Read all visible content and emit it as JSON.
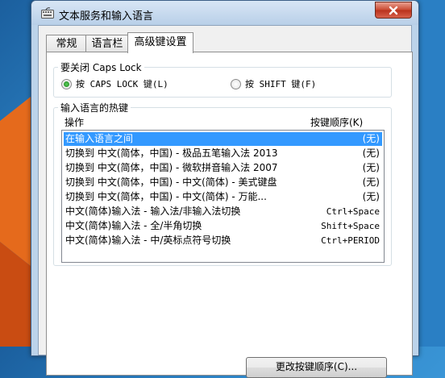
{
  "window": {
    "title": "文本服务和输入语言"
  },
  "tabs": [
    {
      "label": "常规",
      "active": false
    },
    {
      "label": "语言栏",
      "active": false
    },
    {
      "label": "高级键设置",
      "active": true
    }
  ],
  "caps_lock": {
    "group_title": "要关闭 Caps Lock",
    "options": [
      {
        "label": "按 CAPS LOCK 键(L)",
        "selected": true
      },
      {
        "label": "按 SHIFT 键(F)",
        "selected": false
      }
    ]
  },
  "hotkeys": {
    "group_title": "输入语言的热键",
    "col_action": "操作",
    "col_key": "按键顺序(K)",
    "rows": [
      {
        "action": "在输入语言之间",
        "key": "(无)",
        "selected": true
      },
      {
        "action": "切换到 中文(简体，中国) - 极品五笔输入法 2013",
        "key": "(无)",
        "selected": false
      },
      {
        "action": "切换到 中文(简体，中国) - 微软拼音输入法 2007",
        "key": "(无)",
        "selected": false
      },
      {
        "action": "切换到 中文(简体，中国) - 中文(简体) - 美式键盘",
        "key": "(无)",
        "selected": false
      },
      {
        "action": "切换到 中文(简体，中国) - 中文(简体) - 万能...",
        "key": "(无)",
        "selected": false
      },
      {
        "action": "中文(简体)输入法 - 输入法/非输入法切换",
        "key": "Ctrl+Space",
        "selected": false
      },
      {
        "action": "中文(简体)输入法 - 全/半角切换",
        "key": "Shift+Space",
        "selected": false
      },
      {
        "action": "中文(简体)输入法 - 中/英标点符号切换",
        "key": "Ctrl+PERIOD",
        "selected": false
      }
    ]
  },
  "buttons": {
    "change_order": "更改按键顺序(C)..."
  }
}
